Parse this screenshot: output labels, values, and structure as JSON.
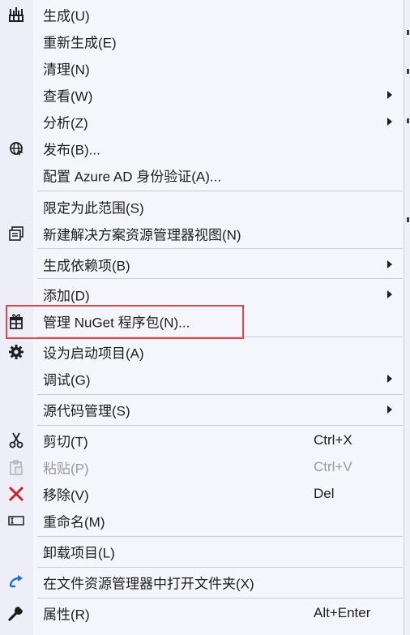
{
  "menu": {
    "items": [
      {
        "label": "生成(U)",
        "icon": "build-icon"
      },
      {
        "label": "重新生成(E)"
      },
      {
        "label": "清理(N)"
      },
      {
        "label": "查看(W)",
        "submenu": true
      },
      {
        "label": "分析(Z)",
        "submenu": true
      },
      {
        "label": "发布(B)...",
        "icon": "publish-globe-icon"
      },
      {
        "label": "配置 Azure AD 身份验证(A)..."
      },
      {
        "label": "限定为此范围(S)"
      },
      {
        "label": "新建解决方案资源管理器视图(N)",
        "icon": "new-view-icon"
      },
      {
        "label": "生成依赖项(B)",
        "submenu": true
      },
      {
        "label": "添加(D)",
        "submenu": true
      },
      {
        "label": "管理 NuGet 程序包(N)...",
        "icon": "nuget-package-icon",
        "highlighted": true
      },
      {
        "label": "设为启动项目(A)",
        "icon": "gear-icon"
      },
      {
        "label": "调试(G)",
        "submenu": true
      },
      {
        "label": "源代码管理(S)",
        "submenu": true
      },
      {
        "label": "剪切(T)",
        "shortcut": "Ctrl+X",
        "icon": "scissors-icon"
      },
      {
        "label": "粘贴(P)",
        "shortcut": "Ctrl+V",
        "icon": "paste-icon",
        "disabled": true
      },
      {
        "label": "移除(V)",
        "shortcut": "Del",
        "icon": "remove-x-icon"
      },
      {
        "label": "重命名(M)",
        "icon": "rename-icon"
      },
      {
        "label": "卸载项目(L)"
      },
      {
        "label": "在文件资源管理器中打开文件夹(X)",
        "icon": "open-folder-arrow-icon"
      },
      {
        "label": "属性(R)",
        "shortcut": "Alt+Enter",
        "icon": "wrench-icon"
      }
    ]
  },
  "colors": {
    "highlight_border": "#e0464d",
    "remove_icon": "#c8202a",
    "open_folder_icon": "#1f6fc5"
  }
}
